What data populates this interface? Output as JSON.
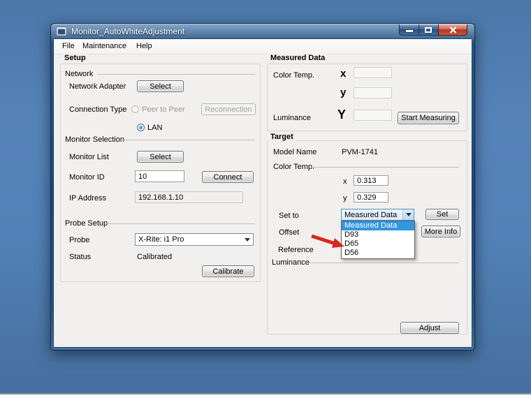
{
  "window": {
    "title": "Monitor_AutoWhiteAdjustment"
  },
  "menu": {
    "file": "File",
    "maintenance": "Maintenance",
    "help": "Help"
  },
  "setup": {
    "title": "Setup",
    "network": {
      "title": "Network",
      "adapter_label": "Network Adapter",
      "select_label": "Select",
      "connection_label": "Connection Type",
      "peer_label": "Peer to Peer",
      "reconnection_label": "Reconnection",
      "lan_label": "LAN"
    },
    "monitor": {
      "title": "Monitor Selection",
      "list_label": "Monitor List",
      "select_label": "Select",
      "id_label": "Monitor ID",
      "id_value": "10",
      "connect_label": "Connect",
      "ip_label": "IP Address",
      "ip_value": "192.168.1.10"
    },
    "probe": {
      "title": "Probe Setup",
      "probe_label": "Probe",
      "probe_value": "X-Rite: i1 Pro",
      "status_label": "Status",
      "status_value": "Calibrated",
      "calibrate_label": "Calibrate"
    }
  },
  "measured": {
    "title": "Measured Data",
    "color_temp_label": "Color Temp.",
    "x_label": "x",
    "y_label": "y",
    "luminance_label": "Luminance",
    "big_y_label": "Y",
    "x_value": "",
    "y_value": "",
    "luminance_value": "",
    "start_label": "Start Measuring"
  },
  "target": {
    "title": "Target",
    "model_label": "Model Name",
    "model_value": "PVM-1741",
    "color_temp_label": "Color Temp.",
    "x_label": "x",
    "x_value": "0.313",
    "y_label": "y",
    "y_value": "0.329",
    "set_to_label": "Set to",
    "combo_value": "Measured Data",
    "set_label": "Set",
    "options": [
      "Measured Data",
      "D93",
      "D65",
      "D56"
    ],
    "selected_option": "Measured Data",
    "offset_label": "Offset",
    "more_info_label": "More Info",
    "reference_label": "Reference",
    "luminance_label": "Luminance",
    "adjust_label": "Adjust"
  },
  "icons": {
    "app": "app-window-icon",
    "minimize": "minimize-icon",
    "maximize": "maximize-icon",
    "close": "close-icon",
    "combo_arrow": "chevron-down-icon",
    "annotation": "red-arrow-icon"
  },
  "colors": {
    "desktop": "#4d7ab1",
    "titlebar": "#1d4978",
    "selection": "#3296e1",
    "close_red": "#c0432c",
    "arrow_red": "#d6281e",
    "client_bg": "#f1f0ee"
  }
}
